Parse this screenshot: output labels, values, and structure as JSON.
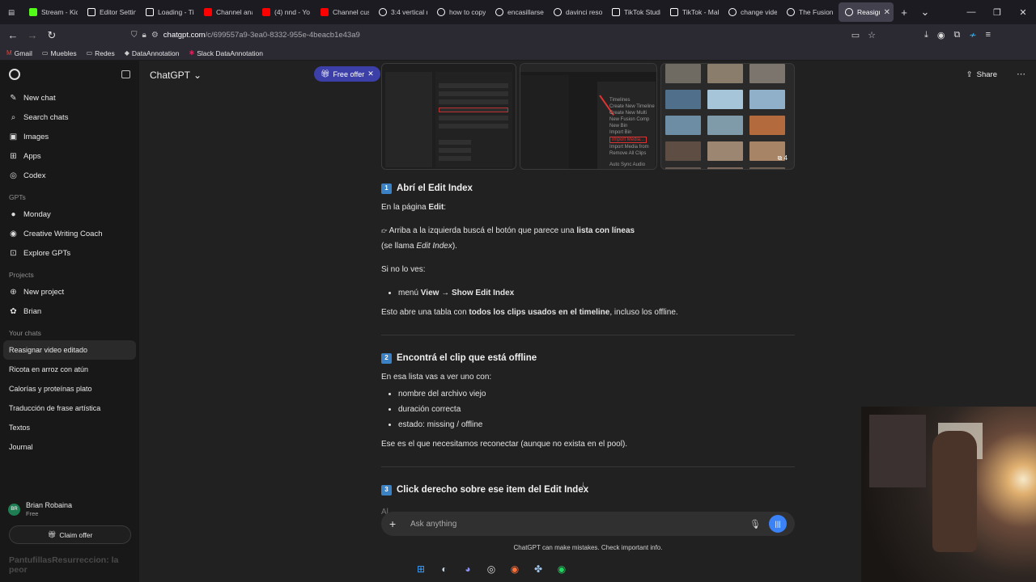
{
  "browser": {
    "tabs": [
      {
        "title": "Stream - Kic",
        "favicon_color": "#53fc18",
        "icon": "kick-icon"
      },
      {
        "title": "Editor Settin",
        "favicon_color": "#ffffff",
        "icon": "tiktok-icon"
      },
      {
        "title": "Loading - TikTok",
        "favicon_color": "#ffffff",
        "icon": "tiktok-icon"
      },
      {
        "title": "Channel ana",
        "favicon_color": "#ff0000",
        "icon": "youtube-icon"
      },
      {
        "title": "(4) nnd - Yo",
        "favicon_color": "#ff0000",
        "icon": "youtube-icon"
      },
      {
        "title": "Channel cus",
        "favicon_color": "#ff0000",
        "icon": "youtube-icon"
      },
      {
        "title": "3:4 vertical r",
        "favicon_color": "#ffffff",
        "icon": "chatgpt-icon"
      },
      {
        "title": "how to copy",
        "favicon_color": "#ffffff",
        "icon": "chatgpt-icon"
      },
      {
        "title": "encasillarse",
        "favicon_color": "#ffffff",
        "icon": "chatgpt-icon"
      },
      {
        "title": "davinci resol",
        "favicon_color": "#ffffff",
        "icon": "chatgpt-icon"
      },
      {
        "title": "TikTok Studio",
        "favicon_color": "#ffffff",
        "icon": "tiktok-icon"
      },
      {
        "title": "TikTok - Make",
        "favicon_color": "#ffffff",
        "icon": "tiktok-icon"
      },
      {
        "title": "change video",
        "favicon_color": "#ffffff",
        "icon": "chatgpt-icon"
      },
      {
        "title": "The Fusion C",
        "favicon_color": "#ffffff",
        "icon": "chatgpt-icon"
      },
      {
        "title": "Reasignar",
        "favicon_color": "#ffffff",
        "icon": "chatgpt-icon",
        "active": true
      }
    ],
    "url_host": "chatgpt.com",
    "url_path": "/c/699557a9-3ea0-8332-955e-4beacb1e43a9",
    "bookmarks": [
      "Gmail",
      "Muebles",
      "Redes",
      "DataAnnotation",
      "Slack DataAnnotation"
    ]
  },
  "sidebar": {
    "top_items": [
      {
        "label": "New chat",
        "icon": "new-chat-icon",
        "glyph": "✎"
      },
      {
        "label": "Search chats",
        "icon": "search-icon",
        "glyph": "⌕"
      },
      {
        "label": "Images",
        "icon": "images-icon",
        "glyph": "▣"
      },
      {
        "label": "Apps",
        "icon": "apps-icon",
        "glyph": "⊞"
      },
      {
        "label": "Codex",
        "icon": "codex-icon",
        "glyph": "◎"
      }
    ],
    "gpts_title": "GPTs",
    "gpts": [
      {
        "label": "Monday",
        "icon": "monday-avatar-icon",
        "glyph": "●"
      },
      {
        "label": "Creative Writing Coach",
        "icon": "writing-coach-avatar-icon",
        "glyph": "◉"
      },
      {
        "label": "Explore GPTs",
        "icon": "explore-gpts-icon",
        "glyph": "⊡"
      }
    ],
    "projects_title": "Projects",
    "projects": [
      {
        "label": "New project",
        "icon": "new-project-icon",
        "glyph": "⊕"
      },
      {
        "label": "Brian",
        "icon": "project-brian-icon",
        "glyph": "✿"
      }
    ],
    "chats_title": "Your chats",
    "chats": [
      "Reasignar video editado",
      "Ricota en arroz con atún",
      "Calorías y proteínas plato",
      "Traducción de frase artística",
      "Textos",
      "Journal"
    ],
    "user_name": "Brian Robaina",
    "user_initials": "BR",
    "user_plan": "Free",
    "claim_label": "Claim offer",
    "ghost_text": "PantufillasResurreccion: la peor"
  },
  "main": {
    "title": "ChatGPT",
    "share_label": "Share",
    "free_offer_label": "Free offer",
    "image_more_count": "4",
    "section1": {
      "num": "1",
      "title": "Abrí el Edit Index",
      "intro_prefix": "En la página ",
      "intro_bold": "Edit",
      "intro_suffix": ":",
      "p1_prefix": "Arriba a la izquierda buscá el botón que parece una ",
      "p1_bold": "lista con líneas",
      "p1_line2_prefix": "(se llama ",
      "p1_line2_italic": "Edit Index",
      "p1_line2_suffix": ").",
      "p2": "Si no lo ves:",
      "bullet_prefix": "menú ",
      "bullet_bold1": "View",
      "bullet_arrow": " → ",
      "bullet_bold2": "Show Edit Index",
      "p3_prefix": "Esto abre una tabla con ",
      "p3_bold": "todos los clips usados en el timeline",
      "p3_suffix": ", incluso los offline."
    },
    "section2": {
      "num": "2",
      "title": "Encontrá el clip que está offline",
      "intro": "En esa lista vas a ver uno con:",
      "bullets": [
        "nombre del archivo viejo",
        "duración correcta",
        "estado: missing / offline"
      ],
      "outro": "Ese es el que necesitamos reconectar (aunque no exista en el pool)."
    },
    "section3": {
      "num": "3",
      "title": "Click derecho sobre ese item del Edit Index",
      "partial": "Al"
    },
    "composer_placeholder": "Ask anything",
    "disclaimer": "ChatGPT can make mistakes. Check important info."
  },
  "taskbar": {
    "apps": [
      {
        "name": "windows-start-icon",
        "glyph": "⊞",
        "color": "#3aa0ff"
      },
      {
        "name": "steam-icon",
        "glyph": "◐",
        "color": "#c6d4df"
      },
      {
        "name": "discord-icon",
        "glyph": "◕",
        "color": "#8a92f2"
      },
      {
        "name": "obs-icon",
        "glyph": "◎",
        "color": "#dddddd"
      },
      {
        "name": "firefox-icon",
        "glyph": "◉",
        "color": "#ff7139"
      },
      {
        "name": "davinci-resolve-icon",
        "glyph": "✤",
        "color": "#9fc3e8"
      },
      {
        "name": "spotify-icon",
        "glyph": "◉",
        "color": "#1ed760"
      }
    ]
  }
}
